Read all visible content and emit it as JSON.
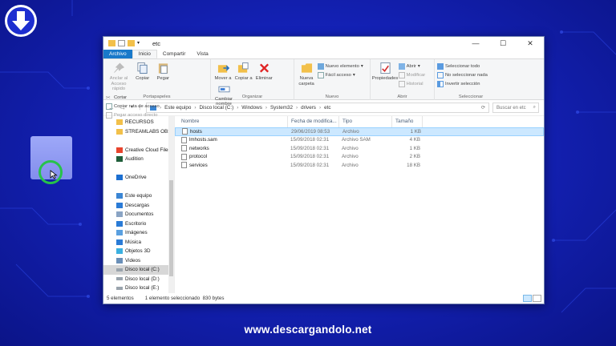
{
  "window": {
    "title": "etc",
    "controls": {
      "minimize": "—",
      "maximize": "☐",
      "close": "✕"
    }
  },
  "tabs": [
    "Archivo",
    "Inicio",
    "Compartir",
    "Vista"
  ],
  "ribbon": {
    "clipboard": {
      "label": "Portapapeles",
      "pin_label": "Anclar al Acceso rápido",
      "copy": "Copiar",
      "paste": "Pegar",
      "cut": "Cortar",
      "copy_path": "Copiar ruta de acceso",
      "paste_shortcut": "Pegar acceso directo"
    },
    "organize": {
      "label": "Organizar",
      "move_to": "Mover a",
      "copy_to": "Copiar a",
      "delete": "Eliminar",
      "rename": "Cambiar nombre"
    },
    "new": {
      "label": "Nuevo",
      "new_folder": "Nueva carpeta",
      "new_item": "Nuevo elemento",
      "easy_access": "Fácil acceso"
    },
    "open": {
      "label": "Abrir",
      "properties": "Propiedades",
      "open": "Abrir",
      "edit": "Modificar",
      "history": "Historial"
    },
    "select": {
      "label": "Seleccionar",
      "select_all": "Seleccionar todo",
      "select_none": "No seleccionar nada",
      "invert": "Invertir selección"
    }
  },
  "address": {
    "path": [
      "Este equipo",
      "Disco local (C:)",
      "Windows",
      "System32",
      "drivers",
      "etc"
    ],
    "search_placeholder": "Buscar en etc"
  },
  "nav": [
    {
      "label": "RECURSOS",
      "icon": "folder-icon"
    },
    {
      "label": "STREAMLABS OBS",
      "icon": "folder-icon"
    },
    {
      "label": "",
      "icon": ""
    },
    {
      "label": "Creative Cloud Files",
      "icon": "cloud-icon"
    },
    {
      "label": "Audition",
      "icon": "audition-icon"
    },
    {
      "label": "",
      "icon": ""
    },
    {
      "label": "OneDrive",
      "icon": "onedrive-icon"
    },
    {
      "label": "",
      "icon": ""
    },
    {
      "label": "Este equipo",
      "icon": "computer-icon"
    },
    {
      "label": "Descargas",
      "icon": "download-icon"
    },
    {
      "label": "Documentos",
      "icon": "documents-icon"
    },
    {
      "label": "Escritorio",
      "icon": "desktop-icon"
    },
    {
      "label": "Imágenes",
      "icon": "pictures-icon"
    },
    {
      "label": "Música",
      "icon": "music-icon"
    },
    {
      "label": "Objetos 3D",
      "icon": "cube-icon"
    },
    {
      "label": "Videos",
      "icon": "video-icon"
    },
    {
      "label": "Disco local (C:)",
      "icon": "drive-icon"
    },
    {
      "label": "Disco local (D:)",
      "icon": "drive-icon"
    },
    {
      "label": "Disco local (E:)",
      "icon": "drive-icon"
    }
  ],
  "columns": {
    "name": "Nombre",
    "date": "Fecha de modifica...",
    "type": "Tipo",
    "size": "Tamaño"
  },
  "files": [
    {
      "name": "hosts",
      "date": "29/06/2019 08:53",
      "type": "Archivo",
      "size": "1 KB"
    },
    {
      "name": "lmhosts.sam",
      "date": "15/09/2018 02:31",
      "type": "Archivo SAM",
      "size": "4 KB"
    },
    {
      "name": "networks",
      "date": "15/09/2018 02:31",
      "type": "Archivo",
      "size": "1 KB"
    },
    {
      "name": "protocol",
      "date": "15/09/2018 02:31",
      "type": "Archivo",
      "size": "2 KB"
    },
    {
      "name": "services",
      "date": "15/09/2018 02:31",
      "type": "Archivo",
      "size": "18 KB"
    }
  ],
  "status": {
    "count": "5 elementos",
    "selection": "1 elemento seleccionado  830 bytes"
  },
  "footer": "www.descargandolo.net",
  "colors": {
    "background": "#1422b8",
    "file_tab": "#1979ca",
    "selection": "#cce8ff"
  }
}
